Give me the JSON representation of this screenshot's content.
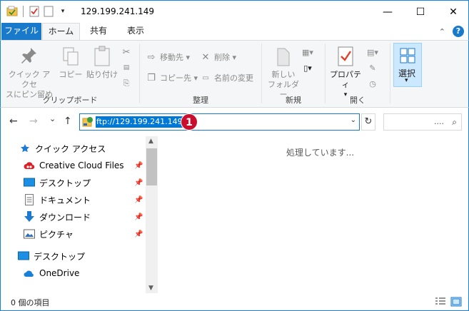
{
  "window": {
    "title": "129.199.241.149",
    "minimize_glyph": "—",
    "maximize_glyph": "☐",
    "close_glyph": "✕"
  },
  "ribbon_tabs": {
    "file": "ファイル",
    "home": "ホーム",
    "share": "共有",
    "view": "表示"
  },
  "ribbon": {
    "clipboard": {
      "label": "クリップボード",
      "pin_line1": "クイック アクセ",
      "pin_line2": "スにピン留め",
      "copy": "コピー",
      "paste": "貼り付け"
    },
    "organize": {
      "label": "整理",
      "move_to": "移動先 ▾",
      "copy_to": "コピー先 ▾",
      "delete": "削除 ▾",
      "rename": "名前の変更"
    },
    "new": {
      "label": "新規",
      "new_folder_line1": "新しい",
      "new_folder_line2": "フォルダー"
    },
    "open": {
      "label": "開く",
      "properties": "プロパティ"
    },
    "select": {
      "label": "選択",
      "arrow": "▾"
    }
  },
  "address": {
    "back": "←",
    "forward": "→",
    "recent": "⌄",
    "up": "↑",
    "value": "ftp://129.199.241.149/",
    "dropdown": "⌄",
    "refresh": "↻",
    "search_placeholder": "...."
  },
  "annotation_badge": "1",
  "navigation": {
    "quick_access": "クイック アクセス",
    "items": [
      {
        "label": "Creative Cloud Files",
        "icon": "creative-cloud-icon",
        "pinned": true
      },
      {
        "label": "デスクトップ",
        "icon": "desktop-icon",
        "pinned": true
      },
      {
        "label": "ドキュメント",
        "icon": "documents-icon",
        "pinned": true
      },
      {
        "label": "ダウンロード",
        "icon": "downloads-icon",
        "pinned": true
      },
      {
        "label": "ピクチャ",
        "icon": "pictures-icon",
        "pinned": true
      }
    ],
    "desktop": "デスクトップ",
    "onedrive": "OneDrive"
  },
  "main": {
    "status_message": "処理しています..."
  },
  "statusbar": {
    "item_count": "0 個の項目"
  },
  "colors": {
    "accent": "#1979ca",
    "window_border": "#1883d7",
    "selection": "#0078d7",
    "badge": "#c8102e"
  }
}
